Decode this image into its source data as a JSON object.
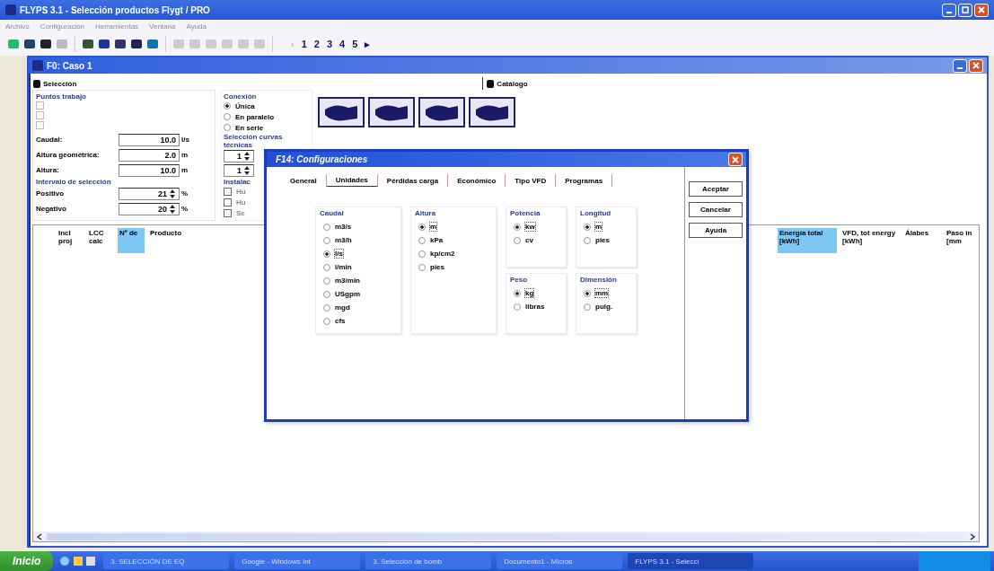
{
  "window": {
    "title": "FLYPS 3.1 - Selección productos Flygt / PRO"
  },
  "menu": [
    "Archivo",
    "Configuración",
    "Herramientas",
    "Ventana",
    "Ayuda"
  ],
  "pager": [
    {
      "label": "‹",
      "disabled": true
    },
    {
      "label": "1",
      "disabled": false
    },
    {
      "label": "2",
      "disabled": false
    },
    {
      "label": "3",
      "disabled": false
    },
    {
      "label": "4",
      "disabled": false
    },
    {
      "label": "5",
      "disabled": false
    },
    {
      "label": "▸",
      "disabled": false
    }
  ],
  "document": {
    "title": "F0: Caso 1",
    "selection_heading": "Selección",
    "catalog_heading": "Catálogo",
    "work_points": {
      "title": "Puntos trabajo",
      "checks": [
        {
          "checked": false,
          "disabled": true
        },
        {
          "checked": false,
          "disabled": true
        },
        {
          "checked": false,
          "disabled": true
        }
      ],
      "fields": [
        {
          "label": "Caudal:",
          "value": "10.0",
          "unit": "l/s"
        },
        {
          "label": "Altura geométrica:",
          "value": "2.0",
          "unit": "m"
        },
        {
          "label": "Altura:",
          "value": "10.0",
          "unit": "m"
        }
      ]
    },
    "interval": {
      "title": "Intervalo de selección",
      "spinners": [
        {
          "label": "Positivo",
          "value": "21",
          "unit": "%"
        },
        {
          "label": "Negativo",
          "value": "20",
          "unit": "%"
        }
      ]
    },
    "connection": {
      "title": "Conexión",
      "options": [
        {
          "label": "Única",
          "selected": true
        },
        {
          "label": "En paralelo",
          "selected": false
        },
        {
          "label": "En serie",
          "selected": false
        }
      ]
    },
    "curves": {
      "title": "Selección curvas técnicas",
      "spinners": [
        "1",
        "1"
      ]
    },
    "installation": {
      "title": "Instalac",
      "options": [
        {
          "label": "Hu",
          "checked": false,
          "disabled": true
        },
        {
          "label": "Hu",
          "checked": false,
          "disabled": true
        },
        {
          "label": "Se",
          "checked": false,
          "disabled": true
        }
      ]
    },
    "table": {
      "columns": [
        {
          "label": "Incl proj",
          "selected": false
        },
        {
          "label": "LCC calc",
          "selected": false
        },
        {
          "label": "Nº de",
          "selected": true
        },
        {
          "label": "Producto",
          "selected": false
        }
      ],
      "right_columns": [
        {
          "label": "Energía total [kWh]",
          "selected": true
        },
        {
          "label": "VFD, tot energy [kWh]",
          "selected": false
        },
        {
          "label": "Álabes",
          "selected": false
        },
        {
          "label": "Paso in [mm",
          "selected": false
        }
      ]
    }
  },
  "dialog": {
    "title": "F14: Configuraciones",
    "tabs": [
      {
        "label": "General",
        "selected": false
      },
      {
        "label": "Unidades",
        "selected": true
      },
      {
        "label": "Pérdidas carga",
        "selected": false
      },
      {
        "label": "Económico",
        "selected": false
      },
      {
        "label": "Tipo VFD",
        "selected": false
      },
      {
        "label": "Programas",
        "selected": false
      }
    ],
    "buttons": [
      "Aceptar",
      "Cancelar",
      "Ayuda"
    ],
    "groups": [
      {
        "title": "Caudal",
        "options": [
          {
            "label": "m3/s",
            "selected": false
          },
          {
            "label": "m3/h",
            "selected": false
          },
          {
            "label": "l/s",
            "selected": true
          },
          {
            "label": "l/min",
            "selected": false
          },
          {
            "label": "m3/min",
            "selected": false
          },
          {
            "label": "USgpm",
            "selected": false
          },
          {
            "label": "mgd",
            "selected": false
          },
          {
            "label": "cfs",
            "selected": false
          }
        ]
      },
      {
        "title": "Altura",
        "options": [
          {
            "label": "m",
            "selected": true
          },
          {
            "label": "kPa",
            "selected": false
          },
          {
            "label": "kp/cm2",
            "selected": false
          },
          {
            "label": "pies",
            "selected": false
          }
        ]
      },
      {
        "title": "Potencia",
        "options": [
          {
            "label": "kw",
            "selected": true
          },
          {
            "label": "cv",
            "selected": false
          }
        ]
      },
      {
        "title": "Longitud",
        "options": [
          {
            "label": "m",
            "selected": true
          },
          {
            "label": "pies",
            "selected": false
          }
        ]
      },
      {
        "title": "Peso",
        "options": [
          {
            "label": "kg",
            "selected": true
          },
          {
            "label": "libras",
            "selected": false
          }
        ]
      },
      {
        "title": "Dimensión",
        "options": [
          {
            "label": "mm",
            "selected": true
          },
          {
            "label": "pulg.",
            "selected": false
          }
        ]
      }
    ]
  },
  "taskbar": {
    "start": "Inicio",
    "tasks": [
      {
        "label": "3. SELECCIÓN DE EQ",
        "selected": false
      },
      {
        "label": "Google - Windows Int",
        "selected": false
      },
      {
        "label": "3. Selección de bomb",
        "selected": false
      },
      {
        "label": "Documento1 - Micros",
        "selected": false
      },
      {
        "label": "FLYPS 3.1 - Selecci",
        "selected": true
      }
    ]
  }
}
